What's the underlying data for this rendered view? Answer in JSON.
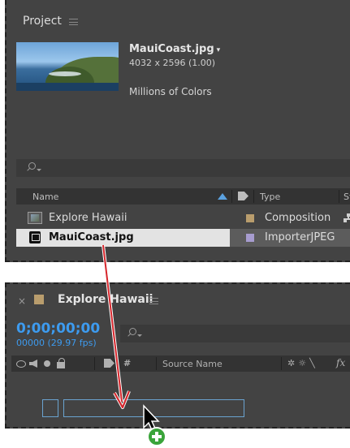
{
  "project": {
    "title": "Project",
    "selected": {
      "name": "MauiCoast.jpg",
      "caret": "▾",
      "dimensions": "4032 x 2596 (1.00)",
      "colors": "Millions of Colors"
    },
    "search": {
      "placeholder": ""
    },
    "columns": {
      "name": "Name",
      "type": "Type",
      "status": "St"
    },
    "items": [
      {
        "label": "Explore Hawaii",
        "type": "Composition",
        "icon": "composition-icon",
        "swatch": "#b99d6d"
      },
      {
        "label": "MauiCoast.jpg",
        "type": "ImporterJPEG",
        "icon": "image-file-icon",
        "swatch": "#a79ccf"
      }
    ]
  },
  "timeline": {
    "close": "×",
    "title": "Explore Hawaii",
    "swatch": "#b99d6d",
    "timecode": "0;00;00;00",
    "frames": "00000 (29.97 fps)",
    "columns": {
      "source_name": "Source Name",
      "fx": "fx"
    }
  },
  "colors": {
    "panel_bg": "#434343",
    "accent_blue": "#3d9bef",
    "arrow_red": "#d6262c",
    "add_green": "#3aa43a"
  }
}
